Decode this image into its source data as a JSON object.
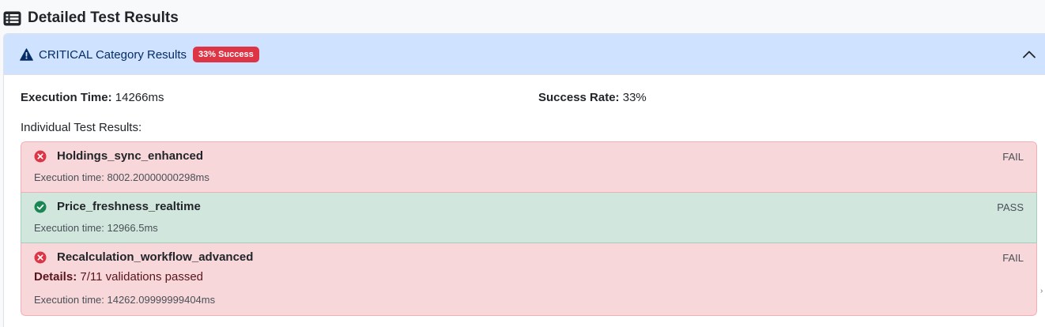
{
  "header": {
    "title": "Detailed Test Results",
    "icon": "list-icon"
  },
  "category": {
    "icon": "warning-triangle-icon",
    "title": "CRITICAL Category Results",
    "badge": "33% Success",
    "badge_color": "#dc3545",
    "header_bg": "#cfe2ff",
    "expanded": true
  },
  "summary": {
    "execution_time_label": "Execution Time:",
    "execution_time_value": "14266ms",
    "success_rate_label": "Success Rate:",
    "success_rate_value": "33%"
  },
  "individual_heading": "Individual Test Results:",
  "results": [
    {
      "name": "Holdings_sync_enhanced",
      "status": "FAIL",
      "icon": "x-circle-icon",
      "execution_time": "Execution time: 8002.20000000298ms"
    },
    {
      "name": "Price_freshness_realtime",
      "status": "PASS",
      "icon": "check-circle-icon",
      "execution_time": "Execution time: 12966.5ms"
    },
    {
      "name": "Recalculation_workflow_advanced",
      "status": "FAIL",
      "icon": "x-circle-icon",
      "details_label": "Details:",
      "details_value": "7/11 validations passed",
      "execution_time": "Execution time: 14262.09999999404ms"
    }
  ],
  "colors": {
    "fail_bg": "#f8d7da",
    "pass_bg": "#d1e7dd",
    "fail_icon": "#dc3545",
    "pass_icon": "#198754"
  }
}
